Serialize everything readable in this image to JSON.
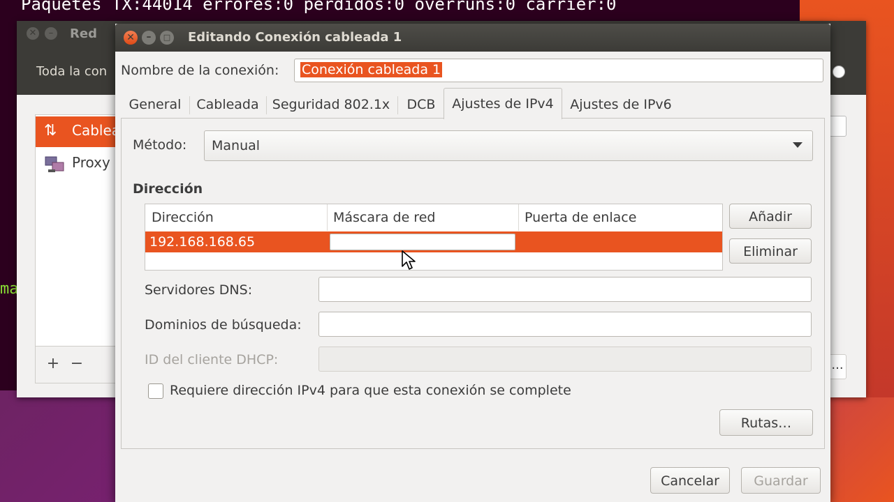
{
  "terminal": {
    "line": "Paquetes TX:44014 errores:0 perdidos:0 overruns:0 carrier:0",
    "fragment": "ma"
  },
  "back_window": {
    "title": "Red",
    "toolbar_text": "Toda la con",
    "sidebar_items": [
      {
        "label": "Cablea",
        "icon": "network-arrows-icon"
      },
      {
        "label": "Proxy",
        "icon": "proxy-icon"
      }
    ],
    "add_symbol": "+",
    "remove_symbol": "−",
    "ellipsis": "..."
  },
  "dialog": {
    "title": "Editando Conexión cableada 1",
    "name_label": "Nombre de la conexión:",
    "name_value": "Conexión cableada 1",
    "tabs": [
      {
        "label": "General"
      },
      {
        "label": "Cableada"
      },
      {
        "label": "Seguridad 802.1x"
      },
      {
        "label": "DCB"
      },
      {
        "label": "Ajustes de IPv4"
      },
      {
        "label": "Ajustes de IPv6"
      }
    ],
    "active_tab": "Ajustes de IPv4",
    "method_label": "Método:",
    "method_value": "Manual",
    "address_section": "Dirección",
    "table": {
      "headers": [
        "Dirección",
        "Máscara de red",
        "Puerta de enlace"
      ],
      "rows": [
        {
          "address": "192.168.168.65",
          "netmask": "",
          "gateway": ""
        }
      ]
    },
    "add_button": "Añadir",
    "delete_button": "Eliminar",
    "dns_label": "Servidores DNS:",
    "dns_value": "",
    "search_domains_label": "Dominios de búsqueda:",
    "search_domains_value": "",
    "dhcp_id_label": "ID del cliente DHCP:",
    "dhcp_id_value": "",
    "require_ipv4_label": "Requiere dirección IPv4 para que esta conexión se complete",
    "require_ipv4_checked": false,
    "routes_button": "Rutas…",
    "cancel_button": "Cancelar",
    "save_button": "Guardar"
  },
  "colors": {
    "accent": "#e95420",
    "titlebar": "#3c3b37",
    "terminal_bg": "#2c001e"
  }
}
